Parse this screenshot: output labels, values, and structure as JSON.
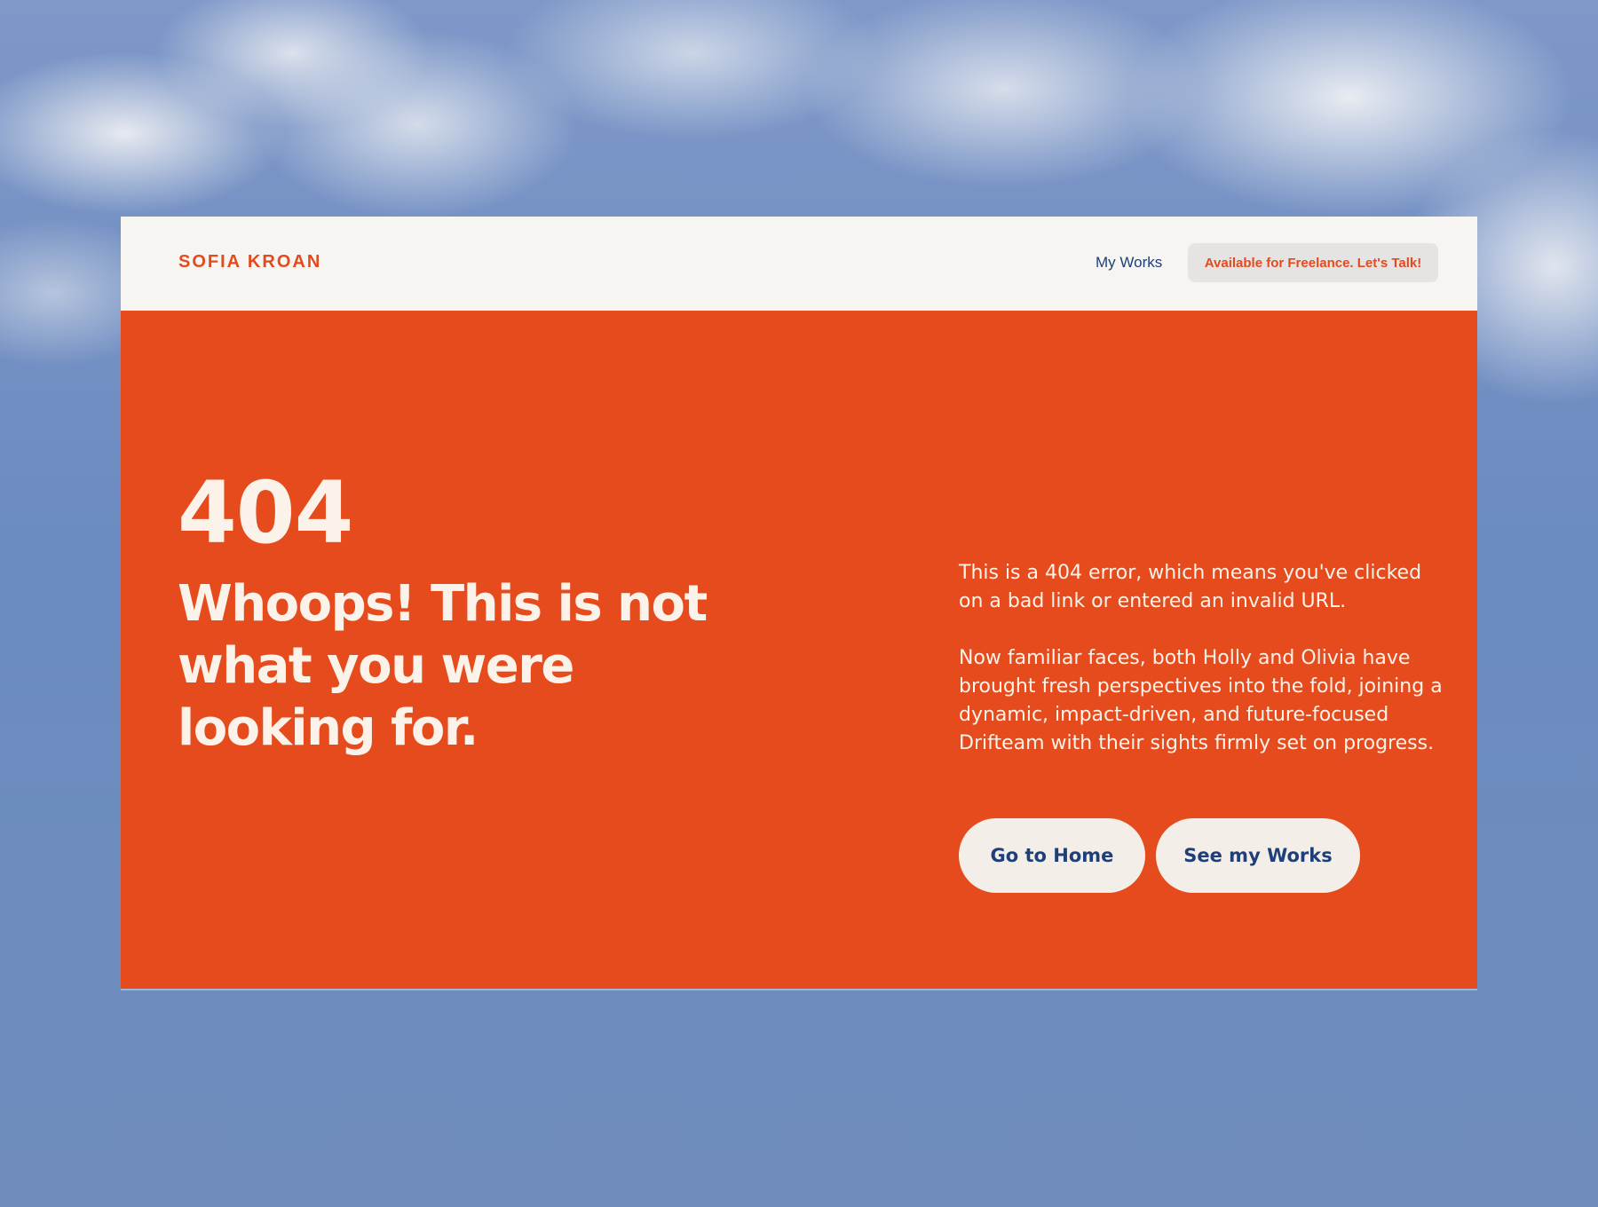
{
  "header": {
    "brand": "SOFIA KROAN",
    "nav_link": "My Works",
    "cta_label": "Available for Freelance. Let's Talk!"
  },
  "hero": {
    "code": "404",
    "headline": "Whoops! This is not what you were looking for.",
    "paragraph_1": "This is a 404 error, which means you've clicked on a bad link or entered an invalid URL.",
    "paragraph_2": "Now familiar faces, both Holly and Olivia have brought fresh perspectives into the fold, joining a dynamic, impact-driven, and future-focused Drifteam with their sights firmly set on progress.",
    "primary_button": "Go to Home",
    "secondary_button": "See my Works"
  },
  "colors": {
    "accent": "#e54b1c",
    "brand_text": "#e34a1e",
    "nav_text": "#1f3f7a",
    "header_bg": "#f6f5f2",
    "button_bg": "#f3efe8",
    "sky": "#6f8dbe"
  }
}
